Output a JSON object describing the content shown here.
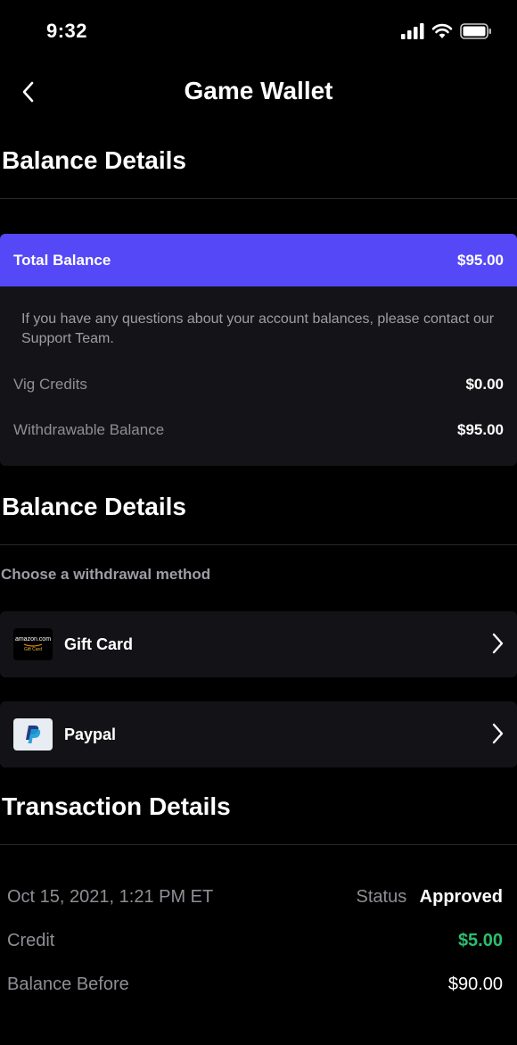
{
  "status_bar": {
    "time": "9:32"
  },
  "nav": {
    "title": "Game Wallet"
  },
  "balance_section": {
    "title": "Balance Details",
    "total_label": "Total Balance",
    "total_value": "$95.00",
    "note": "If you have any questions about your account balances, please contact our Support Team.",
    "rows": [
      {
        "label": "Vig Credits",
        "value": "$0.00"
      },
      {
        "label": "Withdrawable Balance",
        "value": "$95.00"
      }
    ]
  },
  "withdraw_section": {
    "title": "Balance Details",
    "subtitle": "Choose a withdrawal method",
    "methods": [
      {
        "label": "Gift Card",
        "logo_text": "amazon.com",
        "logo_sub": "Gift Card"
      },
      {
        "label": "Paypal"
      }
    ]
  },
  "transaction_section": {
    "title": "Transaction Details",
    "date": "Oct 15, 2021, 1:21 PM ET",
    "status_label": "Status",
    "status_value": "Approved",
    "rows": [
      {
        "label": "Credit",
        "value": "$5.00"
      },
      {
        "label": "Balance Before",
        "value": "$90.00"
      }
    ]
  },
  "colors": {
    "accent": "#5548f7",
    "positive": "#2dbd6e",
    "card": "#141418"
  }
}
